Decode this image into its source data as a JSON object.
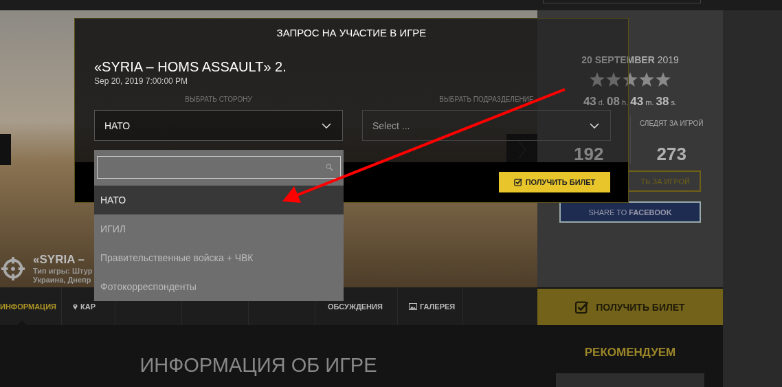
{
  "hero": {
    "title": "«SYRIA –",
    "game_type": "Тип игры: Штур",
    "location": "Украина, Днепр"
  },
  "tabs": [
    {
      "label": "ИНФОРМАЦИЯ",
      "kind": "plain",
      "selected": true
    },
    {
      "label": "КАР",
      "kind": "location",
      "selected": false
    },
    {
      "label": "ОБСУЖДЕНИЯ",
      "kind": "plain",
      "selected": false
    },
    {
      "label": "ГАЛЕРЕЯ",
      "kind": "gallery",
      "selected": false
    }
  ],
  "content": {
    "heading": "ИНФОРМАЦИЯ ОБ ИГРЕ"
  },
  "event_panel": {
    "date": "**20 SEPTEMBER** 2019",
    "stars": 0,
    "countdown": "**43** d. **08** h. **43** m. **38** s.",
    "stats": [
      {
        "value": "192"
      },
      {
        "label": "СЛЕДЯТ ЗА ИГРОЙ",
        "value": "273"
      }
    ],
    "follow_button": "ТЬ ЗА ИГРОЙ",
    "share_button": "SHARE TO **FACEBOOK**",
    "ticket_button": "ПОЛУЧИТЬ БИЛЕТ",
    "recommend_heading": "РЕКОМЕНДУЕМ"
  },
  "modal": {
    "title": "ЗАПРОС НА УЧАСТИЕ В ИГРЕ",
    "game_name": "«SYRIA – HOMS ASSAULT» 2.",
    "game_date": "Sep 20, 2019 7:00:00 PM",
    "side_label": "ВЫБРАТЬ СТОРОНУ",
    "side_value": "НАТО",
    "unit_label": "ВЫБРАТЬ ПОДРАЗДЕЛЕНИЕ",
    "unit_placeholder": "Select ...",
    "ticket_button": "ПОЛУЧИТЬ БИЛЕТ"
  },
  "side_dropdown": {
    "expanded": true,
    "options": [
      {
        "label": "НАТО",
        "selected": true
      },
      {
        "label": "ИГИЛ",
        "selected": false
      },
      {
        "label": "Правительственные войска + ЧВК",
        "selected": false
      },
      {
        "label": "Фотокорреспонденты",
        "selected": false
      }
    ]
  }
}
